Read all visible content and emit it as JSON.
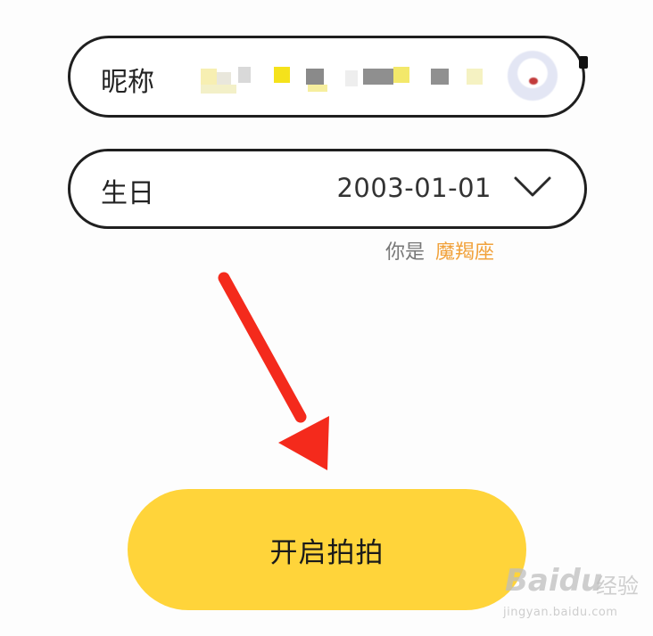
{
  "form": {
    "nickname": {
      "label": "昵称"
    },
    "birthday": {
      "label": "生日",
      "value": "2003-01-01"
    },
    "zodiac": {
      "prefix": "你是",
      "sign": "魔羯座"
    }
  },
  "start_button": {
    "label": "开启拍拍"
  },
  "watermark": {
    "logo": "Baidu",
    "text": "经验",
    "url": "jingyan.baidu.com"
  },
  "colors": {
    "button": "#ffd43a",
    "zodiac_sign": "#f1a23c",
    "arrow": "#f42a1c",
    "field_border": "#1f1f1f"
  },
  "icons": {
    "birthday_dropdown": "chevron-down-icon",
    "annotation": "red-arrow-icon"
  }
}
